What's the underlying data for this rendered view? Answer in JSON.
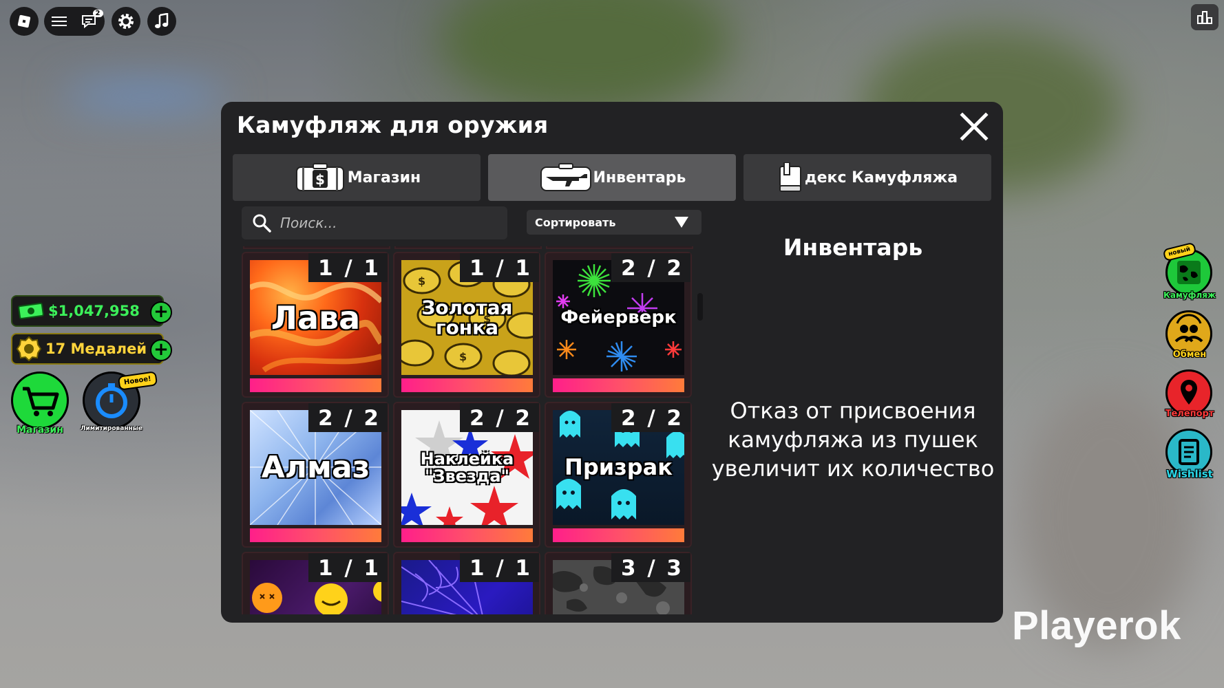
{
  "window": {
    "title": "Камуфляж для оружия",
    "tabs": [
      {
        "label": "Магазин",
        "icon": "money-case-icon"
      },
      {
        "label": "Инвентарь",
        "icon": "rifle-case-icon",
        "active": true
      },
      {
        "label": "декс Камуфляжа",
        "icon": "book-icon"
      }
    ]
  },
  "search": {
    "placeholder": "Поиск..."
  },
  "sort": {
    "label": "Сортировать"
  },
  "items": [
    {
      "name": "Лава",
      "count": "1 / 1"
    },
    {
      "name": "Золотая гонка",
      "count": "1 / 1"
    },
    {
      "name": "Фейерверк",
      "count": "2 / 2"
    },
    {
      "name": "Алмаз",
      "count": "2 / 2"
    },
    {
      "name": "Наклейка \"Звезда\"",
      "count": "2 / 2"
    },
    {
      "name": "Призрак",
      "count": "2 / 2"
    },
    {
      "name": "",
      "count": "1 / 1"
    },
    {
      "name": "",
      "count": "1 / 1"
    },
    {
      "name": "",
      "count": "3 / 3"
    }
  ],
  "info": {
    "title": "Инвентарь",
    "text": "Отказ от присвоения камуфляжа из пушек увеличит их количество"
  },
  "hud": {
    "money": "$1,047,958",
    "medals": "17 Медалей",
    "shop_label": "Магазин",
    "limited_label": "Лимитированные",
    "limited_badge": "Новое!",
    "chat_badge": "2"
  },
  "right_hud": {
    "camo_label": "Камуфляж",
    "camo_badge": "новый",
    "trade_label": "Обмен",
    "teleport_label": "Телепорт",
    "wishlist_label": "Wishlist"
  },
  "watermark": "Playerok",
  "colors": {
    "panel": "#222224",
    "tab_active": "#5a5a5c",
    "money_green": "#3cf05a",
    "medal_gold": "#ffd43b",
    "rarity_from": "#ff1f8a",
    "rarity_to": "#ff7b3a"
  }
}
